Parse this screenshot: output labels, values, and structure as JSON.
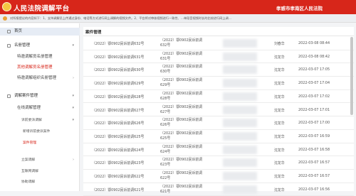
{
  "header": {
    "title": "人民法院调解平台",
    "court": "孝感市孝南区人民法院"
  },
  "notice": {
    "text": "对所报提议的内容如下：1、支持调解员上传通过身份、电话等方式进行网上调解的视频文件。2、平台将对审核视频进行一致性、…单段音视频时长的比较进行网上调…"
  },
  "sidebar": {
    "items": [
      {
        "label": "首页"
      },
      {
        "label": "名册管理"
      },
      {
        "label": "特邀调解员名册管理"
      },
      {
        "label": "其他调解员名册管理"
      },
      {
        "label": "特邀调解组织名册管理"
      },
      {
        "label": "调解案件管理"
      },
      {
        "label": "在线调解管理"
      },
      {
        "label": "诉前委派调解"
      },
      {
        "label": "新增诉前委派案件"
      },
      {
        "label": "案件管理"
      },
      {
        "label": "立案调解"
      },
      {
        "label": "互联网调解"
      },
      {
        "label": "协助调解"
      }
    ]
  },
  "main": {
    "tab": "案件管理",
    "rows": [
      {
        "case_no": "（2022）鄂0902民诉前调632号",
        "case_no2": "（2022）鄂0902民诉前调632号",
        "person": "刘春华",
        "time": "2022-03-08 08:44"
      },
      {
        "case_no": "（2022）鄂0902民诉前调631号",
        "case_no2": "（2022）鄂0902民诉前调631号",
        "person": "沈龙华",
        "time": "2022-03-08 08:42"
      },
      {
        "case_no": "（2022）鄂0902民诉前调630号",
        "case_no2": "（2022）鄂0902民诉前调630号",
        "person": "沈龙华",
        "time": "2022-03-07 17:05"
      },
      {
        "case_no": "（2022）鄂0902民诉前调629号",
        "case_no2": "（2022）鄂0902民诉前调629号",
        "person": "沈龙华",
        "time": "2022-03-07 17:04"
      },
      {
        "case_no": "（2022）鄂0902民诉前调628号",
        "case_no2": "（2022）鄂0902民诉前调628号",
        "person": "沈龙华",
        "time": "2022-03-07 17:02"
      },
      {
        "case_no": "（2022）鄂0902民诉前调627号",
        "case_no2": "（2022）鄂0902民诉前调627号",
        "person": "沈龙华",
        "time": "2022-03-07 17:01"
      },
      {
        "case_no": "（2022）鄂0902民诉前调626号",
        "case_no2": "（2022）鄂0902民诉前调626号",
        "person": "沈龙华",
        "time": "2022-03-07 17:00"
      },
      {
        "case_no": "（2022）鄂0902民诉前调625号",
        "case_no2": "（2022）鄂0902民诉前调625号",
        "person": "沈龙华",
        "time": "2022-03-07 16:59"
      },
      {
        "case_no": "（2022）鄂0902民诉前调624号",
        "case_no2": "（2022）鄂0902民诉前调624号",
        "person": "沈龙华",
        "time": "2022-03-07 16:58"
      },
      {
        "case_no": "（2022）鄂0902民诉前调623号",
        "case_no2": "（2022）鄂0902民诉前调623号",
        "person": "沈龙华",
        "time": "2022-03-07 16:57"
      },
      {
        "case_no": "（2022）鄂0902民诉前调622号",
        "case_no2": "（2022）鄂0902民诉前调622号",
        "person": "沈龙华",
        "time": "2022-03-07 16:57"
      },
      {
        "case_no": "（2022）鄂0902民诉前调621号",
        "case_no2": "（2022）鄂0902民诉前调621号",
        "person": "沈龙华",
        "time": "2022-03-07 16:56"
      }
    ]
  },
  "colors": {
    "brand": "#d7261a",
    "selected": "#e6ecf5"
  }
}
